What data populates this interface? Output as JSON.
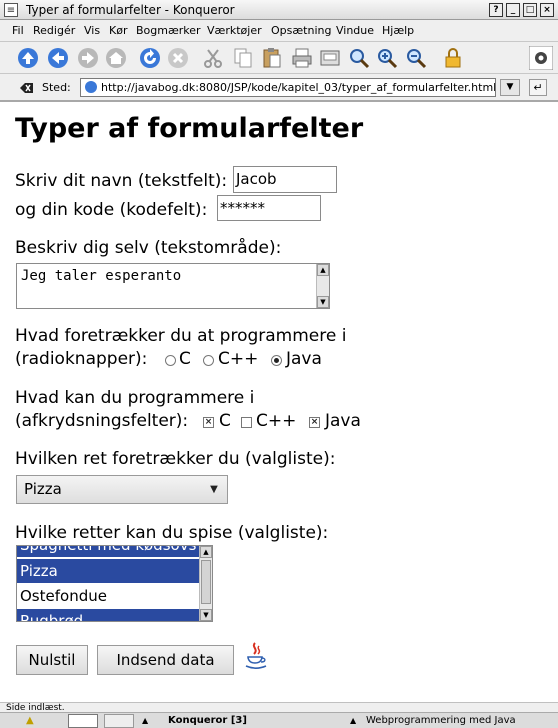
{
  "window": {
    "title": "Typer af formularfelter - Konqueror",
    "buttons": [
      "?",
      "_",
      "□",
      "×"
    ]
  },
  "menu": [
    "Fil",
    "Redigér",
    "Vis",
    "Kør",
    "Bogmærker",
    "Værktøjer",
    "Opsætning",
    "Vindue",
    "Hjælp"
  ],
  "toolbar": {
    "icons": [
      "up-arrow-icon",
      "back-arrow-icon",
      "forward-arrow-icon",
      "home-icon",
      "reload-icon",
      "stop-icon",
      "cut-icon",
      "copy-icon",
      "paste-icon",
      "print-icon",
      "save-icon",
      "find-icon",
      "zoom-in-icon",
      "zoom-out-icon",
      "lock-icon"
    ]
  },
  "location": {
    "label": "Sted:",
    "url": "http://javabog.dk:8080/JSP/kode/kapitel_03/typer_af_formularfelter.html"
  },
  "page": {
    "heading": "Typer af formularfelter",
    "name_label": "Skriv dit navn (tekstfelt):",
    "name_value": "Jacob",
    "code_label": "og din kode (kodefelt):",
    "code_value": "******",
    "describe_label": "Beskriv dig selv (tekstområde):",
    "describe_value": "Jeg taler esperanto",
    "radio_label_1": "Hvad foretrækker du at programmere i",
    "radio_label_2": "(radioknapper):",
    "radio_options": [
      "C",
      "C++",
      "Java"
    ],
    "radio_selected": "Java",
    "check_label_1": "Hvad kan du programmere i",
    "check_label_2": "(afkrydsningsfelter):",
    "check_options": [
      "C",
      "C++",
      "Java"
    ],
    "check_checked": [
      "C",
      "Java"
    ],
    "select_label": "Hvilken ret foretrækker du (valgliste):",
    "select_value": "Pizza",
    "list_label": "Hvilke retter kan du spise (valgliste):",
    "list_items": [
      "Spaghetti med kødsovs",
      "Pizza",
      "Ostefondue",
      "Rugbrød"
    ],
    "list_selected": [
      "Spaghetti med kødsovs",
      "Pizza",
      "Rugbrød"
    ],
    "reset_button": "Nulstil",
    "submit_button": "Indsend data"
  },
  "status": "Side indlæst.",
  "taskbar": {
    "task1": "Konqueror [3]",
    "task2": "Webprogrammering med Java"
  }
}
